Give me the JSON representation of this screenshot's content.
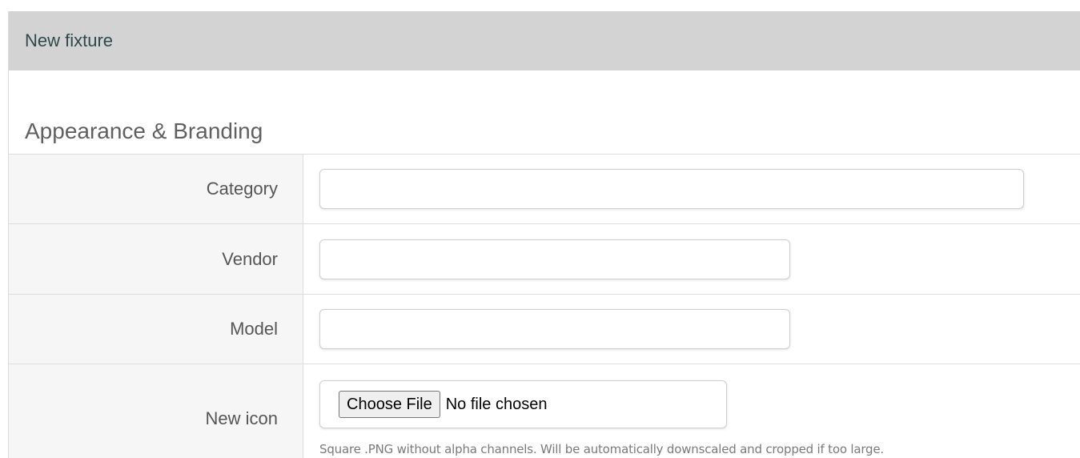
{
  "panel": {
    "title": "New fixture"
  },
  "section": {
    "title": "Appearance & Branding"
  },
  "form": {
    "category": {
      "label": "Category",
      "value": ""
    },
    "vendor": {
      "label": "Vendor",
      "value": ""
    },
    "model": {
      "label": "Model",
      "value": ""
    },
    "icon": {
      "label": "New icon",
      "button_label": "Choose File",
      "status": "No file chosen",
      "help": "Square .PNG without alpha channels. Will be automatically downscaled and cropped if too large."
    }
  }
}
